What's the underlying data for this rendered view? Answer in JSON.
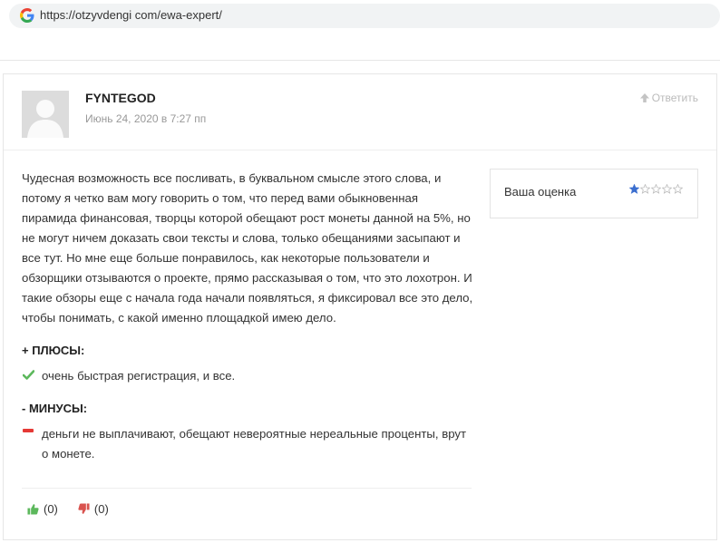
{
  "browser": {
    "url": "https://otzyvdengi com/ewa-expert/"
  },
  "comment": {
    "author": "FYNTEGOD",
    "date": "Июнь 24, 2020 в 7:27 пп",
    "reply_label": "Ответить",
    "text": "Чудесная возможность все посливать, в буквальном смысле этого слова, и потому я четко вам могу говорить о том, что перед вами обыкновенная пирамида финансовая, творцы которой обещают рост монеты данной на 5%, но не могут ничем доказать свои тексты и слова, только обещаниями засыпают и все тут. Но мне еще больше понравилось, как некоторые пользователи и обзорщики отзываются о проекте, прямо рассказывая о том, что это лохотрон. И такие обзоры еще с начала года начали появляться, я фиксировал все это дело, чтобы понимать, с какой именно площадкой имею дело.",
    "pros_title": "+ ПЛЮСЫ:",
    "pros": [
      "очень быстрая регистрация, и все."
    ],
    "cons_title": "- МИНУСЫ:",
    "cons": [
      "деньги не выплачивают, обещают невероятные нереальные проценты, врут о монете."
    ],
    "rating": {
      "label": "Ваша оценка",
      "value": 1,
      "max": 5
    },
    "likes": "(0)",
    "dislikes": "(0)"
  },
  "colors": {
    "like": "#5cb85c",
    "dislike": "#d9534f",
    "star": "#3b6ecf",
    "star_empty": "#bbbbbb",
    "pros_check": "#5cb85c",
    "cons_dash": "#e53935"
  }
}
